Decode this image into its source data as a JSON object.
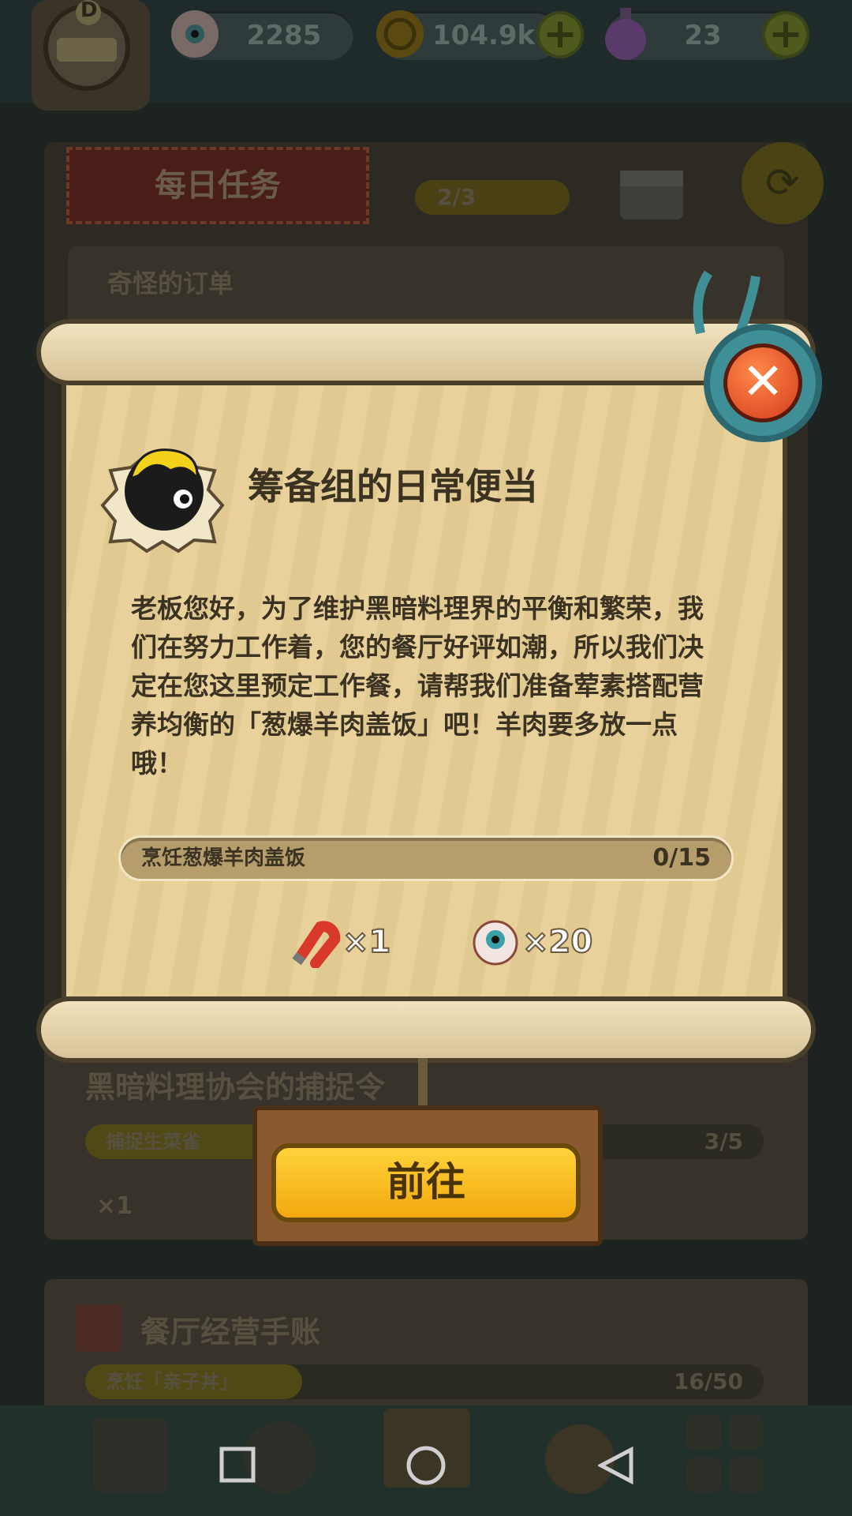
{
  "topbar": {
    "player_rank": "D",
    "eyeballs": "2285",
    "coins": "104.9k",
    "potions": "23"
  },
  "daily": {
    "tab_title": "每日任务",
    "progress": "2/3"
  },
  "bg_tasks": [
    {
      "title": "奇怪的订单"
    },
    {
      "title": "黑暗料理协会的捕捉令",
      "sub": "捕捉生菜雀",
      "count": "3/5",
      "reward": "×1",
      "fill": 0.6
    },
    {
      "title": "餐厅经营手账",
      "sub": "烹饪「亲子丼」",
      "count": "16/50",
      "fill": 0.32
    }
  ],
  "quest": {
    "title": "筹备组的日常便当",
    "description": "老板您好，为了维护黑暗料理界的平衡和繁荣，我们在努力工作着，您的餐厅好评如潮，所以我们决定在您这里预定工作餐，请帮我们准备荤素搭配营养均衡的「葱爆羊肉盖饭」吧！羊肉要多放一点哦！",
    "progress_label": "烹饪葱爆羊肉盖饭",
    "progress_count": "0/15",
    "rewards": [
      {
        "icon": "magnet-icon",
        "qty": "×1"
      },
      {
        "icon": "eyeball-icon",
        "qty": "×20"
      }
    ],
    "go_label": "前往"
  },
  "colors": {
    "accent": "#f2b10f",
    "paper": "#e8cf97",
    "close": "#d53b1c"
  }
}
